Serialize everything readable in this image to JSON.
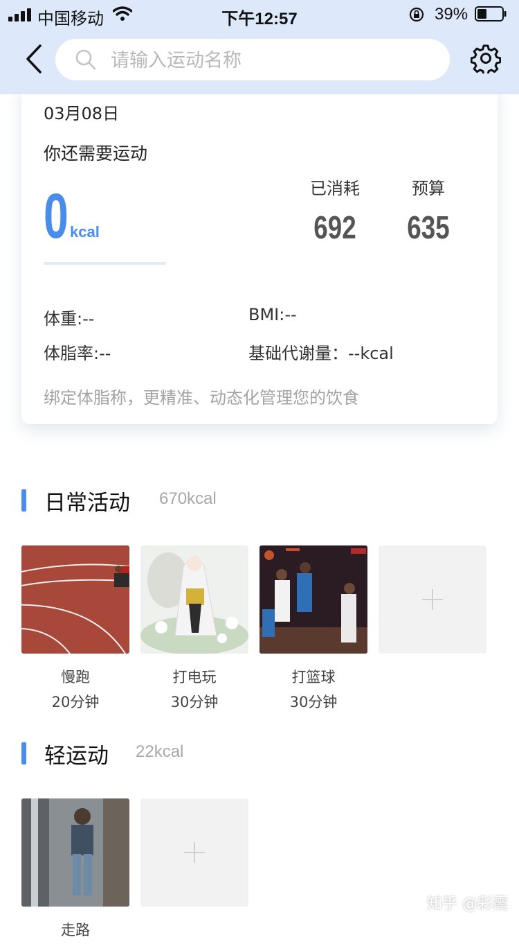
{
  "status_bar": {
    "carrier": "中国移动",
    "time": "下午12:57",
    "battery_percent": "39%",
    "battery_level": 0.39
  },
  "header": {
    "search_placeholder": "请输入运动名称",
    "icons": [
      "back-arrow-icon",
      "search-icon",
      "gear-icon"
    ]
  },
  "summary": {
    "date": "03月08日",
    "need_label": "你还需要运动",
    "remaining_value": "0",
    "remaining_unit": "kcal",
    "progress": 0,
    "consumed_label": "已消耗",
    "consumed_value": "692",
    "budget_label": "预算",
    "budget_value": "635",
    "weight": "体重:--",
    "bmi": "BMI:--",
    "body_fat": "体脂率:--",
    "bmr": "基础代谢量：--kcal",
    "hint": "绑定体脂称，更精准、动态化管理您的饮食"
  },
  "sections": [
    {
      "title": "日常活动",
      "kcal": "670kcal",
      "items": [
        {
          "name": "慢跑",
          "duration": "20分钟",
          "image": "running-track-photo"
        },
        {
          "name": "打电玩",
          "duration": "30分钟",
          "image": "anime-character-illustration"
        },
        {
          "name": "打篮球",
          "duration": "30分钟",
          "image": "basketball-game-photo"
        }
      ]
    },
    {
      "title": "轻运动",
      "kcal": "22kcal",
      "items": [
        {
          "name": "走路",
          "duration": "",
          "image": "person-walking-photo"
        }
      ]
    }
  ],
  "accent_color": "#4a8cec",
  "watermark": "知乎 @彩霞"
}
